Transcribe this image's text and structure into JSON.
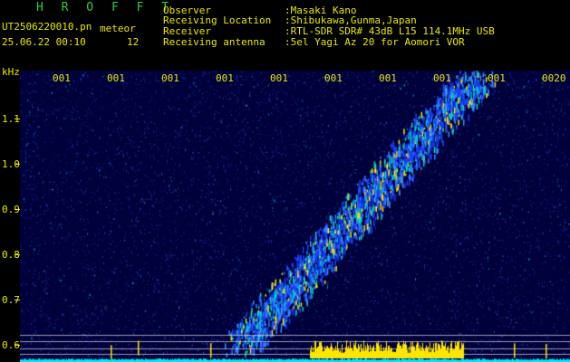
{
  "header": {
    "app_title": "H R O F F T",
    "filename": "UT2506220010.pn",
    "meteor_label": "meteor",
    "date_time": "25.06.22 00:10",
    "meteor_count": "12",
    "observer_label": "Observer",
    "observer_value": ":Masaki Kano",
    "location_label": "Receiving Location",
    "location_value": ":Shibukawa,Gunma,Japan",
    "receiver_label": "Receiver",
    "receiver_value": ":RTL-SDR SDR# 43dB L15 114.1MHz USB",
    "antenna_label": "Receiving antenna",
    "antenna_value": ":5el Yagi Az 20 for Aomori VOR"
  },
  "axis": {
    "unit": "kHz",
    "ticks": [
      {
        "label": "1.1",
        "value": 1.1
      },
      {
        "label": "1.0",
        "value": 1.0
      },
      {
        "label": "0.9",
        "value": 0.9
      },
      {
        "label": "0.8",
        "value": 0.8
      },
      {
        "label": "0.7",
        "value": 0.7
      },
      {
        "label": "0.6",
        "value": 0.6
      }
    ]
  },
  "time_labels": [
    "001",
    "001",
    "001",
    "001",
    "001",
    "001",
    "001",
    "001",
    "001",
    "0020"
  ],
  "colors": {
    "background": "#00003a",
    "text": "#e8e800",
    "title": "#2ecc40",
    "signal_low": "#1b3cff",
    "signal_mid": "#00e0c0",
    "signal_high": "#ffe600",
    "noise_floor": "#00e8ff"
  }
}
